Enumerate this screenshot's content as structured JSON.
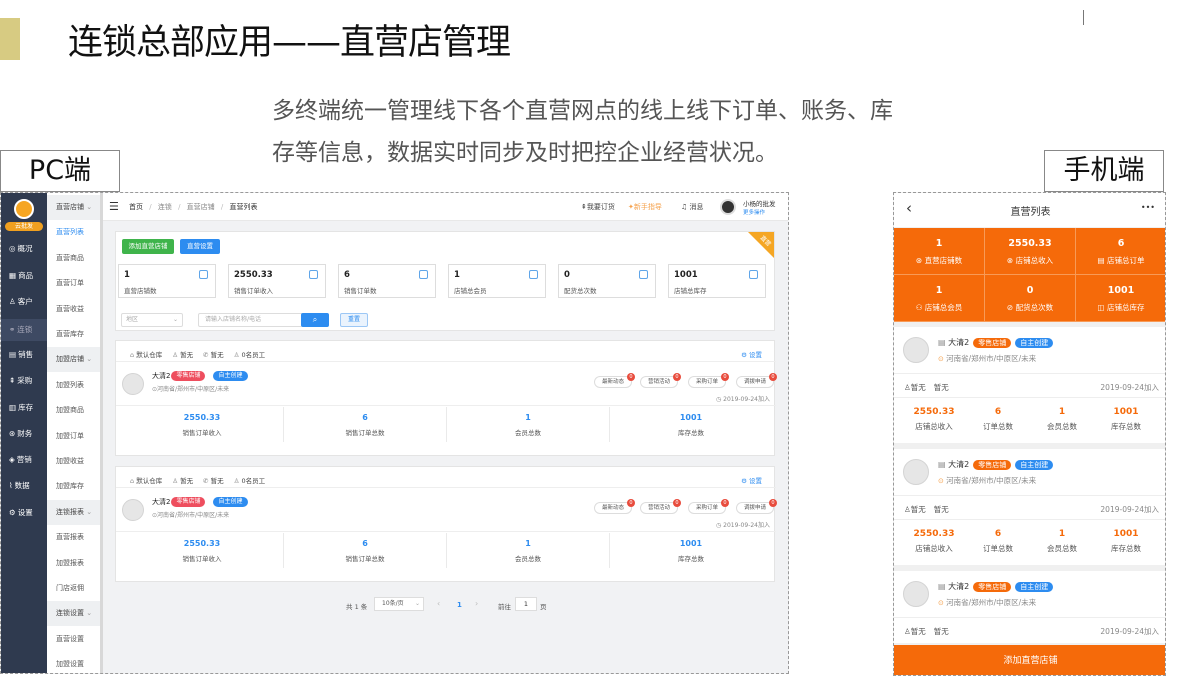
{
  "slide": {
    "title": "连锁总部应用——直营店管理",
    "subtitle": "多终端统一管理线下各个直营网点的线上线下订单、账务、库存等信息，数据实时同步及时把控企业经营状况。",
    "pc_label": "PC端",
    "mobile_label": "手机端"
  },
  "pc": {
    "logo_text": "云批发",
    "side_items": [
      "概况",
      "商品",
      "客户",
      "连锁",
      "销售",
      "采购",
      "库存",
      "财务",
      "营销",
      "数据",
      "设置"
    ],
    "side_icons": [
      "gauge-icon",
      "grid-icon",
      "user-icon",
      "link-icon",
      "document-icon",
      "cart-icon",
      "warehouse-icon",
      "money-icon",
      "megaphone-icon",
      "chart-icon",
      "gear-icon"
    ],
    "sub_items": [
      {
        "label": "直营店铺",
        "type": "header"
      },
      {
        "label": "直营列表",
        "type": "active"
      },
      {
        "label": "直营商品",
        "type": "item"
      },
      {
        "label": "直营订单",
        "type": "item"
      },
      {
        "label": "直营收益",
        "type": "item"
      },
      {
        "label": "直营库存",
        "type": "item"
      },
      {
        "label": "加盟店铺",
        "type": "header"
      },
      {
        "label": "加盟列表",
        "type": "item"
      },
      {
        "label": "加盟商品",
        "type": "item"
      },
      {
        "label": "加盟订单",
        "type": "item"
      },
      {
        "label": "加盟收益",
        "type": "item"
      },
      {
        "label": "加盟库存",
        "type": "item"
      },
      {
        "label": "连锁报表",
        "type": "header"
      },
      {
        "label": "直营报表",
        "type": "item"
      },
      {
        "label": "加盟报表",
        "type": "item"
      },
      {
        "label": "门店返佣",
        "type": "item"
      },
      {
        "label": "连锁设置",
        "type": "header"
      },
      {
        "label": "直营设置",
        "type": "item"
      },
      {
        "label": "加盟设置",
        "type": "item"
      }
    ],
    "breadcrumb": [
      "首页",
      "连锁",
      "直营店铺",
      "直营列表"
    ],
    "top_actions": {
      "order": "我要订货",
      "guide": "新手指导",
      "message": "消息",
      "user_name": "小杨的批发",
      "more": "更多操作"
    },
    "buttons": {
      "add": "添加直营店铺",
      "settings": "直营设置",
      "reset": "重置"
    },
    "corner_badge": "直营",
    "stats": [
      {
        "value": "1",
        "label": "直营店铺数"
      },
      {
        "value": "2550.33",
        "label": "销售订单收入"
      },
      {
        "value": "6",
        "label": "销售订单数"
      },
      {
        "value": "1",
        "label": "店铺总会员"
      },
      {
        "value": "0",
        "label": "配货总次数"
      },
      {
        "value": "1001",
        "label": "店铺总库存"
      }
    ],
    "filter": {
      "region_placeholder": "地区",
      "search_placeholder": "请输入店铺名称/电话"
    },
    "store_cards": [
      {
        "warehouse": "默认仓库",
        "manager": "暂无",
        "phone": "暂无",
        "staff": "0名员工",
        "settings": "设置",
        "name": "大清2",
        "tag_retail": "零售店铺",
        "tag_self": "自主创建",
        "address": "河南省/郑州市/中原区/未来",
        "pills": [
          {
            "label": "最新动态",
            "count": "0"
          },
          {
            "label": "营销活动",
            "count": "0"
          },
          {
            "label": "采购订单",
            "count": "0"
          },
          {
            "label": "调拨申请",
            "count": "0"
          }
        ],
        "date": "2019-09-24加入",
        "stats": [
          {
            "value": "2550.33",
            "label": "销售订单收入"
          },
          {
            "value": "6",
            "label": "销售订单总数"
          },
          {
            "value": "1",
            "label": "会员总数"
          },
          {
            "value": "1001",
            "label": "库存总数"
          }
        ]
      },
      {
        "warehouse": "默认仓库",
        "manager": "暂无",
        "phone": "暂无",
        "staff": "0名员工",
        "settings": "设置",
        "name": "大清2",
        "tag_retail": "零售店铺",
        "tag_self": "自主创建",
        "address": "河南省/郑州市/中原区/未来",
        "pills": [
          {
            "label": "最新动态",
            "count": "0"
          },
          {
            "label": "营销活动",
            "count": "0"
          },
          {
            "label": "采购订单",
            "count": "0"
          },
          {
            "label": "调拨申请",
            "count": "0"
          }
        ],
        "date": "2019-09-24加入",
        "stats": [
          {
            "value": "2550.33",
            "label": "销售订单收入"
          },
          {
            "value": "6",
            "label": "销售订单总数"
          },
          {
            "value": "1",
            "label": "会员总数"
          },
          {
            "value": "1001",
            "label": "库存总数"
          }
        ]
      }
    ],
    "pagination": {
      "total": "共 1 条",
      "page_size": "10条/页",
      "current": "1",
      "goto": "前往",
      "goto_value": "1",
      "page_unit": "页"
    }
  },
  "mobile": {
    "title": "直营列表",
    "more": "•••",
    "stats": [
      {
        "value": "1",
        "label": "直营店铺数"
      },
      {
        "value": "2550.33",
        "label": "店铺总收入"
      },
      {
        "value": "6",
        "label": "店铺总订单"
      },
      {
        "value": "1",
        "label": "店铺总会员"
      },
      {
        "value": "0",
        "label": "配货总次数"
      },
      {
        "value": "1001",
        "label": "店铺总库存"
      }
    ],
    "cards": [
      {
        "name": "大清2",
        "tag_retail": "零售店铺",
        "tag_self": "自主创建",
        "address": "河南省/郑州市/中原区/未来",
        "manager_label": "暂无",
        "manager": "暂无",
        "date": "2019-09-24加入",
        "stats": [
          {
            "value": "2550.33",
            "label": "店铺总收入"
          },
          {
            "value": "6",
            "label": "订单总数"
          },
          {
            "value": "1",
            "label": "会员总数"
          },
          {
            "value": "1001",
            "label": "库存总数"
          }
        ]
      },
      {
        "name": "大清2",
        "tag_retail": "零售店铺",
        "tag_self": "自主创建",
        "address": "河南省/郑州市/中原区/未来",
        "manager_label": "暂无",
        "manager": "暂无",
        "date": "2019-09-24加入",
        "stats": [
          {
            "value": "2550.33",
            "label": "店铺总收入"
          },
          {
            "value": "6",
            "label": "订单总数"
          },
          {
            "value": "1",
            "label": "会员总数"
          },
          {
            "value": "1001",
            "label": "库存总数"
          }
        ]
      },
      {
        "name": "大清2",
        "tag_retail": "零售店铺",
        "tag_self": "自主创建",
        "address": "河南省/郑州市/中原区/未来",
        "manager_label": "暂无",
        "manager": "暂无",
        "date": "2019-09-24加入"
      }
    ],
    "add_button": "添加直营店铺"
  },
  "colors": {
    "primary": "#2d8cf0",
    "green": "#3fb44b",
    "orange": "#f56a0a",
    "sidebar": "#2f3a4f",
    "tag_red": "#ee4e5e",
    "accent_bar": "#d7cb82"
  }
}
